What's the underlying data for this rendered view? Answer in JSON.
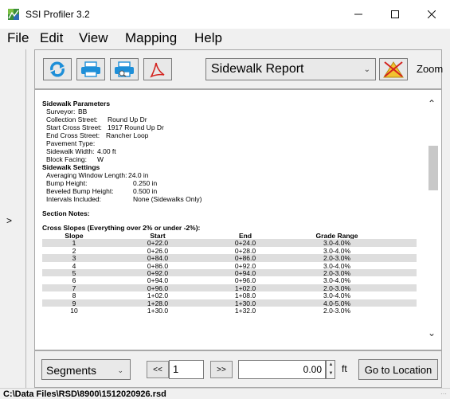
{
  "window": {
    "title": "SSI Profiler 3.2"
  },
  "menu": [
    "File",
    "Edit",
    "View",
    "Mapping",
    "Help"
  ],
  "toolbar": {
    "report_type": "Sidewalk Report",
    "zoom_label": "Zoom"
  },
  "report": {
    "params_heading": "Sidewalk Parameters",
    "params": [
      {
        "label": "Surveyor:",
        "value": "BB"
      },
      {
        "label": "Collection Street:",
        "value": "Round Up Dr"
      },
      {
        "label": "Start Cross Street:",
        "value": "1917 Round Up Dr"
      },
      {
        "label": "End Cross Street:",
        "value": "Rancher Loop"
      },
      {
        "label": "Pavement Type:",
        "value": ""
      },
      {
        "label": "Sidewalk Width:",
        "value": "4.00 ft"
      },
      {
        "label": "Block Facing:",
        "value": "W"
      }
    ],
    "settings_heading": "Sidewalk Settings",
    "settings": [
      {
        "label": "Averaging Window Length:",
        "value": "24.0 in"
      },
      {
        "label": "Bump Height:",
        "value": "0.250 in"
      },
      {
        "label": "Beveled Bump Height:",
        "value": "0.500 in"
      },
      {
        "label": "Intervals Included:",
        "value": "None (Sidewalks Only)"
      }
    ],
    "section_notes": "Section Notes:",
    "cross_slopes_heading": "Cross Slopes (Everything over 2% or under -2%):",
    "cross_slopes_columns": [
      "Slope",
      "Start",
      "End",
      "Grade Range"
    ],
    "cross_slopes_rows": [
      [
        "1",
        "0+22.0",
        "0+24.0",
        "3.0-4.0%"
      ],
      [
        "2",
        "0+26.0",
        "0+28.0",
        "3.0-4.0%"
      ],
      [
        "3",
        "0+84.0",
        "0+86.0",
        "2.0-3.0%"
      ],
      [
        "4",
        "0+86.0",
        "0+92.0",
        "3.0-4.0%"
      ],
      [
        "5",
        "0+92.0",
        "0+94.0",
        "2.0-3.0%"
      ],
      [
        "6",
        "0+94.0",
        "0+96.0",
        "3.0-4.0%"
      ],
      [
        "7",
        "0+96.0",
        "1+02.0",
        "2.0-3.0%"
      ],
      [
        "8",
        "1+02.0",
        "1+08.0",
        "3.0-4.0%"
      ],
      [
        "9",
        "1+28.0",
        "1+30.0",
        "4.0-5.0%"
      ],
      [
        "10",
        "1+30.0",
        "1+32.0",
        "2.0-3.0%"
      ]
    ]
  },
  "nav": {
    "segment_type": "Segments",
    "prev_label": "<<",
    "page_value": "1",
    "next_label": ">>",
    "location_value": "0.00",
    "unit": "ft",
    "goto_label": "Go to Location"
  },
  "status": {
    "path": "C:\\Data Files\\RSD\\8900\\1512020926.rsd"
  },
  "colors": {
    "pdf_red": "#d4231f",
    "refresh_blue": "#1e8fd8",
    "printer_blue": "#1e8fd8"
  }
}
